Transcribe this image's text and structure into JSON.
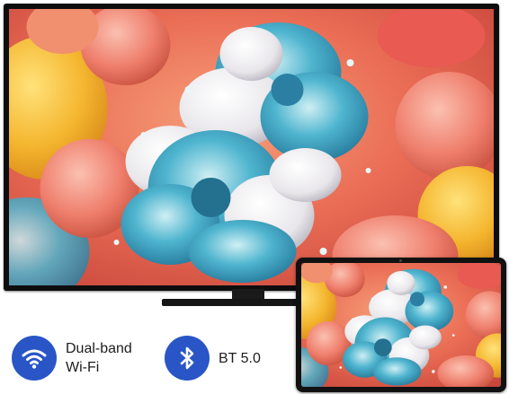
{
  "features": {
    "wifi": {
      "line1": "Dual-band",
      "line2": "Wi-Fi",
      "icon": "wifi-icon"
    },
    "bluetooth": {
      "label": "BT 5.0",
      "icon": "bluetooth-icon"
    }
  },
  "colors": {
    "icon_bg": "#2955c6",
    "icon_fg": "#ffffff",
    "text": "#1d1d1d",
    "bezel": "#0d0d0d"
  },
  "devices": [
    "tv",
    "monitor"
  ]
}
